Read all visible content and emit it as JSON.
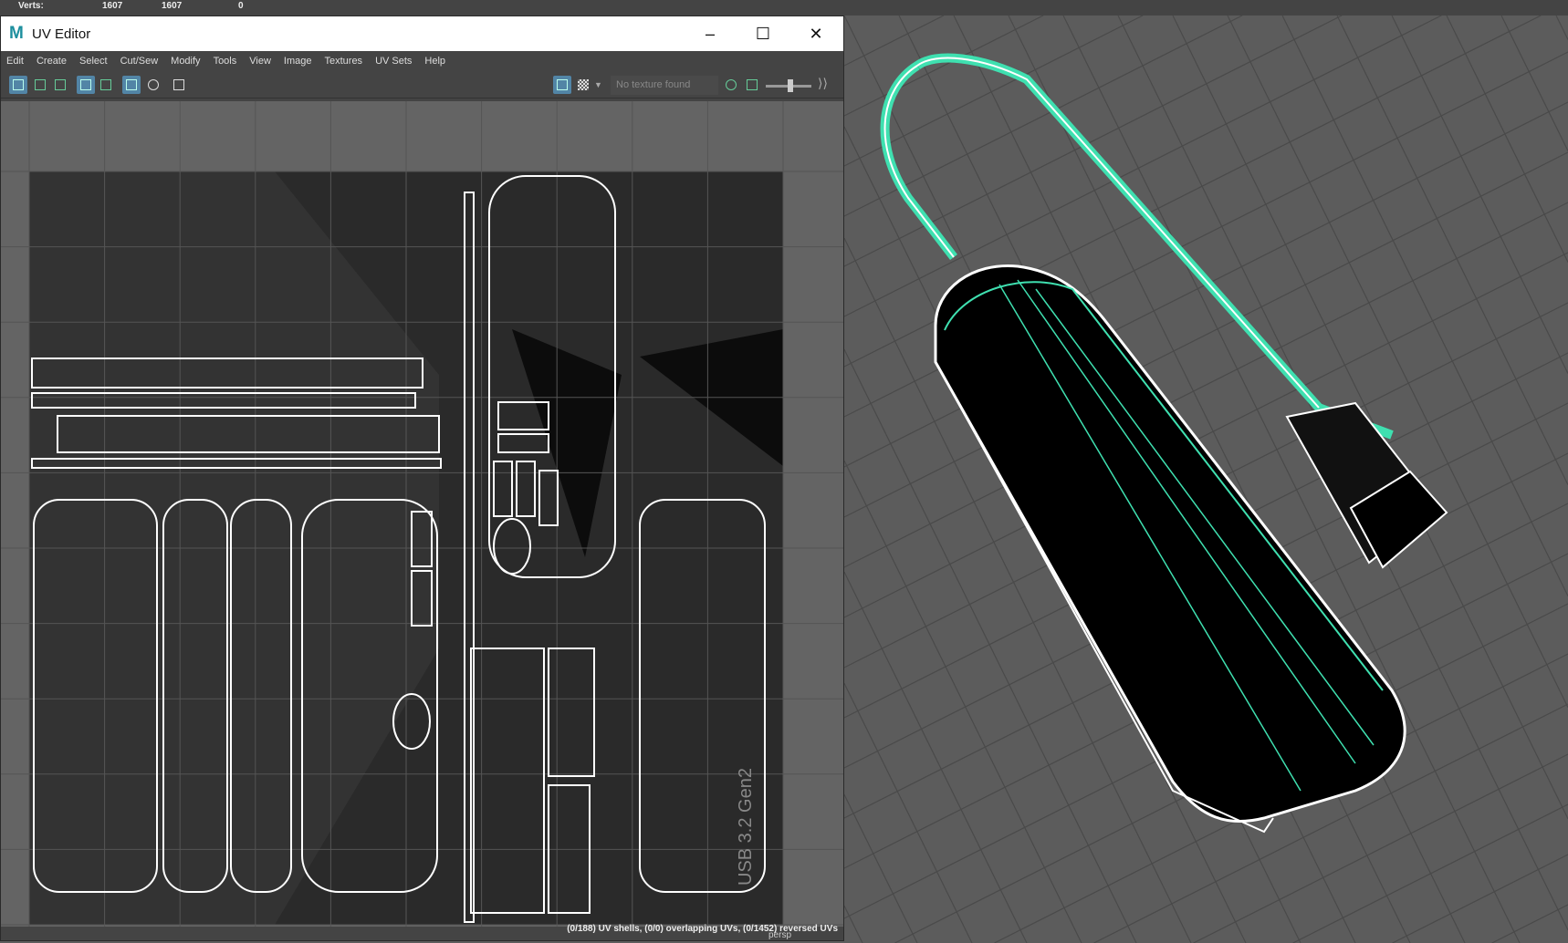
{
  "hud": {
    "label": "Verts:",
    "values": [
      "1607",
      "1607",
      "0"
    ]
  },
  "window": {
    "title": "UV Editor",
    "minimize": "–",
    "maximize": "☐",
    "close": "✕",
    "logo": "M"
  },
  "menu": [
    "Edit",
    "Create",
    "Select",
    "Cut/Sew",
    "Modify",
    "Tools",
    "View",
    "Image",
    "Textures",
    "UV Sets",
    "Help"
  ],
  "toolbar": {
    "texture_field": "No texture found"
  },
  "status": "(0/188) UV shells, (0/0) overlapping UVs, (0/1452) reversed UVs",
  "viewport": {
    "camera": "persp"
  },
  "uv": {
    "label": "USB 3.2 Gen2"
  },
  "colors": {
    "accent": "#5285a6",
    "wire": "#3fe0b0"
  }
}
